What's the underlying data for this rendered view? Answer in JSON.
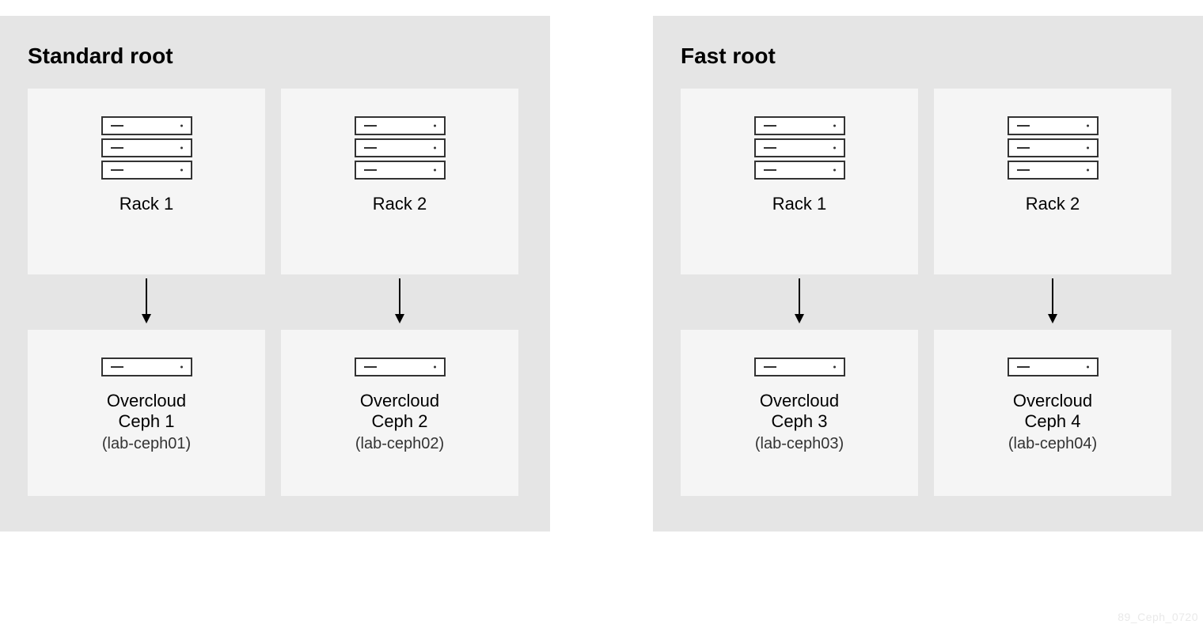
{
  "roots": [
    {
      "title": "Standard root",
      "columns": [
        {
          "rack_label": "Rack 1",
          "node_title": "Overcloud",
          "node_sub": "Ceph 1",
          "node_host": "(lab-ceph01)"
        },
        {
          "rack_label": "Rack 2",
          "node_title": "Overcloud",
          "node_sub": "Ceph 2",
          "node_host": "(lab-ceph02)"
        }
      ]
    },
    {
      "title": "Fast root",
      "columns": [
        {
          "rack_label": "Rack 1",
          "node_title": "Overcloud",
          "node_sub": "Ceph 3",
          "node_host": "(lab-ceph03)"
        },
        {
          "rack_label": "Rack 2",
          "node_title": "Overcloud",
          "node_sub": "Ceph 4",
          "node_host": "(lab-ceph04)"
        }
      ]
    }
  ],
  "footer_code": "89_Ceph_0720"
}
